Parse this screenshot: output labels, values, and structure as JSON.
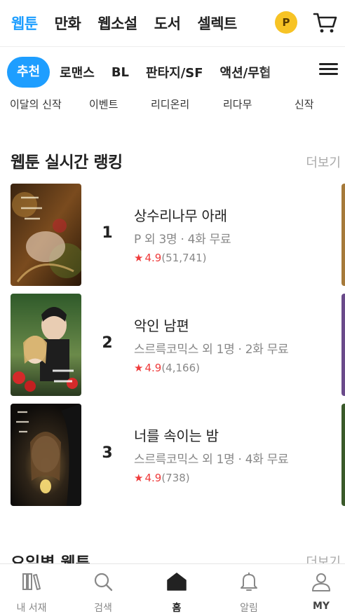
{
  "topnav": {
    "items": [
      {
        "label": "웹툰",
        "active": true
      },
      {
        "label": "만화",
        "active": false
      },
      {
        "label": "웹소설",
        "active": false
      },
      {
        "label": "도서",
        "active": false
      },
      {
        "label": "셀렉트",
        "active": false
      }
    ],
    "coin_label": "P",
    "icons": {
      "cart": "cart-icon"
    }
  },
  "genres": {
    "items": [
      "추천",
      "로맨스",
      "BL",
      "판타지/SF",
      "액션/무협"
    ],
    "active_index": 0,
    "menu_icon": "hamburger-menu-icon"
  },
  "submenu": {
    "items": [
      "이달의 신작",
      "이벤트",
      "리디온리",
      "리다무",
      "신작"
    ]
  },
  "ranking": {
    "title": "웹툰 실시간 랭킹",
    "more_label": "더보기",
    "items": [
      {
        "rank": "1",
        "title": "상수리나무 아래",
        "meta": "P 외 3명 · 4화 무료",
        "score": "4.9",
        "count": "(51,741)"
      },
      {
        "rank": "2",
        "title": "악인 남편",
        "meta": "스르륵코믹스 외 1명 · 2화 무료",
        "score": "4.9",
        "count": "(4,166)"
      },
      {
        "rank": "3",
        "title": "너를 속이는 밤",
        "meta": "스르륵코믹스 외 1명 · 4화 무료",
        "score": "4.9",
        "count": "(738)"
      }
    ]
  },
  "next_section": {
    "title": "요일별 웹툰",
    "more_label": "더보기"
  },
  "bottomnav": {
    "items": [
      {
        "label": "내 서재",
        "icon": "library-icon"
      },
      {
        "label": "검색",
        "icon": "search-icon"
      },
      {
        "label": "홈",
        "icon": "home-icon"
      },
      {
        "label": "알림",
        "icon": "bell-icon"
      },
      {
        "label": "MY",
        "icon": "user-icon"
      }
    ],
    "active_index": 2
  },
  "colors": {
    "accent": "#1e9eff",
    "rating": "#ef3b3b",
    "coin": "#f7c325"
  }
}
